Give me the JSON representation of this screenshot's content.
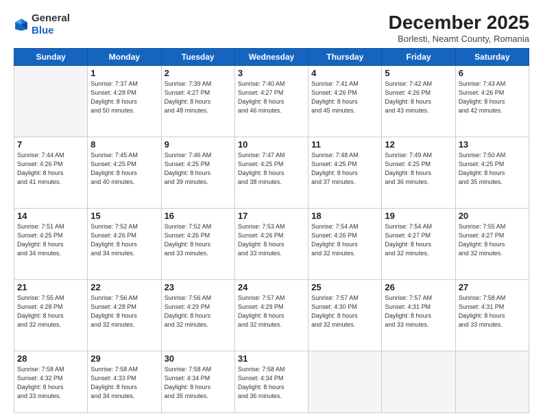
{
  "header": {
    "logo": {
      "general": "General",
      "blue": "Blue"
    },
    "title": "December 2025",
    "location": "Borlesti, Neamt County, Romania"
  },
  "days_of_week": [
    "Sunday",
    "Monday",
    "Tuesday",
    "Wednesday",
    "Thursday",
    "Friday",
    "Saturday"
  ],
  "weeks": [
    [
      {
        "day": "",
        "info": ""
      },
      {
        "day": "1",
        "info": "Sunrise: 7:37 AM\nSunset: 4:28 PM\nDaylight: 8 hours\nand 50 minutes."
      },
      {
        "day": "2",
        "info": "Sunrise: 7:39 AM\nSunset: 4:27 PM\nDaylight: 8 hours\nand 48 minutes."
      },
      {
        "day": "3",
        "info": "Sunrise: 7:40 AM\nSunset: 4:27 PM\nDaylight: 8 hours\nand 46 minutes."
      },
      {
        "day": "4",
        "info": "Sunrise: 7:41 AM\nSunset: 4:26 PM\nDaylight: 8 hours\nand 45 minutes."
      },
      {
        "day": "5",
        "info": "Sunrise: 7:42 AM\nSunset: 4:26 PM\nDaylight: 8 hours\nand 43 minutes."
      },
      {
        "day": "6",
        "info": "Sunrise: 7:43 AM\nSunset: 4:26 PM\nDaylight: 8 hours\nand 42 minutes."
      }
    ],
    [
      {
        "day": "7",
        "info": "Sunrise: 7:44 AM\nSunset: 4:26 PM\nDaylight: 8 hours\nand 41 minutes."
      },
      {
        "day": "8",
        "info": "Sunrise: 7:45 AM\nSunset: 4:25 PM\nDaylight: 8 hours\nand 40 minutes."
      },
      {
        "day": "9",
        "info": "Sunrise: 7:46 AM\nSunset: 4:25 PM\nDaylight: 8 hours\nand 39 minutes."
      },
      {
        "day": "10",
        "info": "Sunrise: 7:47 AM\nSunset: 4:25 PM\nDaylight: 8 hours\nand 38 minutes."
      },
      {
        "day": "11",
        "info": "Sunrise: 7:48 AM\nSunset: 4:25 PM\nDaylight: 8 hours\nand 37 minutes."
      },
      {
        "day": "12",
        "info": "Sunrise: 7:49 AM\nSunset: 4:25 PM\nDaylight: 8 hours\nand 36 minutes."
      },
      {
        "day": "13",
        "info": "Sunrise: 7:50 AM\nSunset: 4:25 PM\nDaylight: 8 hours\nand 35 minutes."
      }
    ],
    [
      {
        "day": "14",
        "info": "Sunrise: 7:51 AM\nSunset: 4:25 PM\nDaylight: 8 hours\nand 34 minutes."
      },
      {
        "day": "15",
        "info": "Sunrise: 7:52 AM\nSunset: 4:26 PM\nDaylight: 8 hours\nand 34 minutes."
      },
      {
        "day": "16",
        "info": "Sunrise: 7:52 AM\nSunset: 4:26 PM\nDaylight: 8 hours\nand 33 minutes."
      },
      {
        "day": "17",
        "info": "Sunrise: 7:53 AM\nSunset: 4:26 PM\nDaylight: 8 hours\nand 33 minutes."
      },
      {
        "day": "18",
        "info": "Sunrise: 7:54 AM\nSunset: 4:26 PM\nDaylight: 8 hours\nand 32 minutes."
      },
      {
        "day": "19",
        "info": "Sunrise: 7:54 AM\nSunset: 4:27 PM\nDaylight: 8 hours\nand 32 minutes."
      },
      {
        "day": "20",
        "info": "Sunrise: 7:55 AM\nSunset: 4:27 PM\nDaylight: 8 hours\nand 32 minutes."
      }
    ],
    [
      {
        "day": "21",
        "info": "Sunrise: 7:55 AM\nSunset: 4:28 PM\nDaylight: 8 hours\nand 32 minutes."
      },
      {
        "day": "22",
        "info": "Sunrise: 7:56 AM\nSunset: 4:28 PM\nDaylight: 8 hours\nand 32 minutes."
      },
      {
        "day": "23",
        "info": "Sunrise: 7:56 AM\nSunset: 4:29 PM\nDaylight: 8 hours\nand 32 minutes."
      },
      {
        "day": "24",
        "info": "Sunrise: 7:57 AM\nSunset: 4:29 PM\nDaylight: 8 hours\nand 32 minutes."
      },
      {
        "day": "25",
        "info": "Sunrise: 7:57 AM\nSunset: 4:30 PM\nDaylight: 8 hours\nand 32 minutes."
      },
      {
        "day": "26",
        "info": "Sunrise: 7:57 AM\nSunset: 4:31 PM\nDaylight: 8 hours\nand 33 minutes."
      },
      {
        "day": "27",
        "info": "Sunrise: 7:58 AM\nSunset: 4:31 PM\nDaylight: 8 hours\nand 33 minutes."
      }
    ],
    [
      {
        "day": "28",
        "info": "Sunrise: 7:58 AM\nSunset: 4:32 PM\nDaylight: 8 hours\nand 33 minutes."
      },
      {
        "day": "29",
        "info": "Sunrise: 7:58 AM\nSunset: 4:33 PM\nDaylight: 8 hours\nand 34 minutes."
      },
      {
        "day": "30",
        "info": "Sunrise: 7:58 AM\nSunset: 4:34 PM\nDaylight: 8 hours\nand 35 minutes."
      },
      {
        "day": "31",
        "info": "Sunrise: 7:58 AM\nSunset: 4:34 PM\nDaylight: 8 hours\nand 36 minutes."
      },
      {
        "day": "",
        "info": ""
      },
      {
        "day": "",
        "info": ""
      },
      {
        "day": "",
        "info": ""
      }
    ]
  ]
}
